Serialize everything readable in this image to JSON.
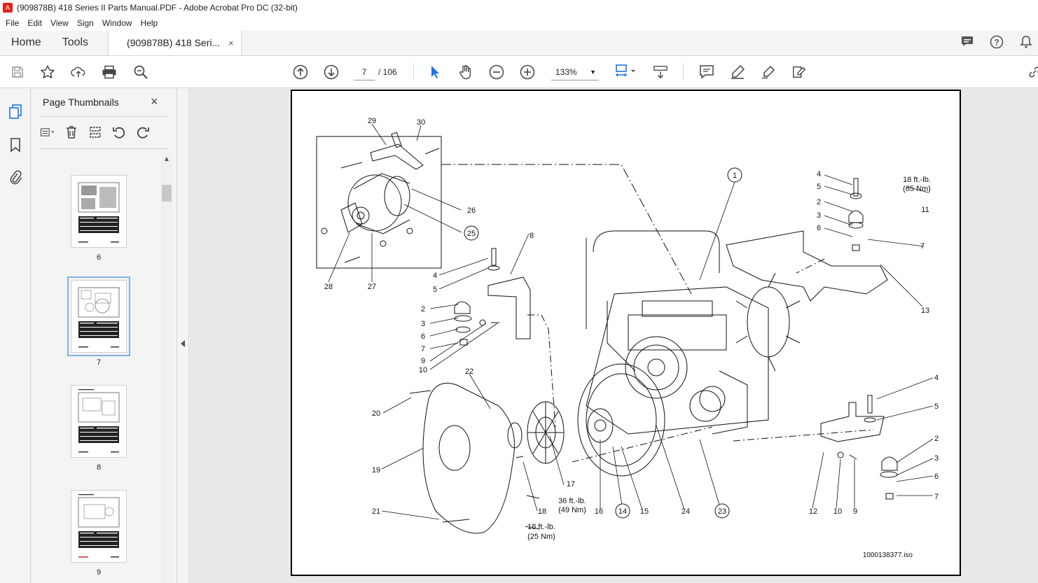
{
  "window": {
    "title": "(909878B) 418 Series II Parts Manual.PDF - Adobe Acrobat Pro DC (32-bit)"
  },
  "menu": [
    "File",
    "Edit",
    "View",
    "Sign",
    "Window",
    "Help"
  ],
  "tabs": {
    "home": "Home",
    "tools": "Tools",
    "document": "(909878B) 418 Seri...",
    "close": "×"
  },
  "toolbar": {
    "page_current": "7",
    "page_total": "/ 106",
    "zoom": "133%"
  },
  "thumbnails": {
    "title": "Page Thumbnails",
    "close": "×",
    "pages": [
      {
        "label": "6",
        "selected": false
      },
      {
        "label": "7",
        "selected": true
      },
      {
        "label": "8",
        "selected": false
      },
      {
        "label": "9",
        "selected": false
      }
    ]
  },
  "diagram": {
    "callouts": [
      "29",
      "30",
      "26",
      "25",
      "28",
      "27",
      "8",
      "4",
      "5",
      "2",
      "3",
      "6",
      "7",
      "9",
      "10",
      "22",
      "20",
      "19",
      "21",
      "18",
      "17",
      "16",
      "14",
      "15",
      "24",
      "23",
      "1",
      "11",
      "13",
      "12"
    ],
    "torque_1_line1": "18 ft.-lb.",
    "torque_1_line2": "(65 Nm)",
    "torque_2_line1": "36 ft.-lb.",
    "torque_2_line2": "(49 Nm)",
    "torque_3_line1": "18 ft.-lb.",
    "torque_3_line2": "(25 Nm)",
    "file_id": "1000138377.iso"
  }
}
